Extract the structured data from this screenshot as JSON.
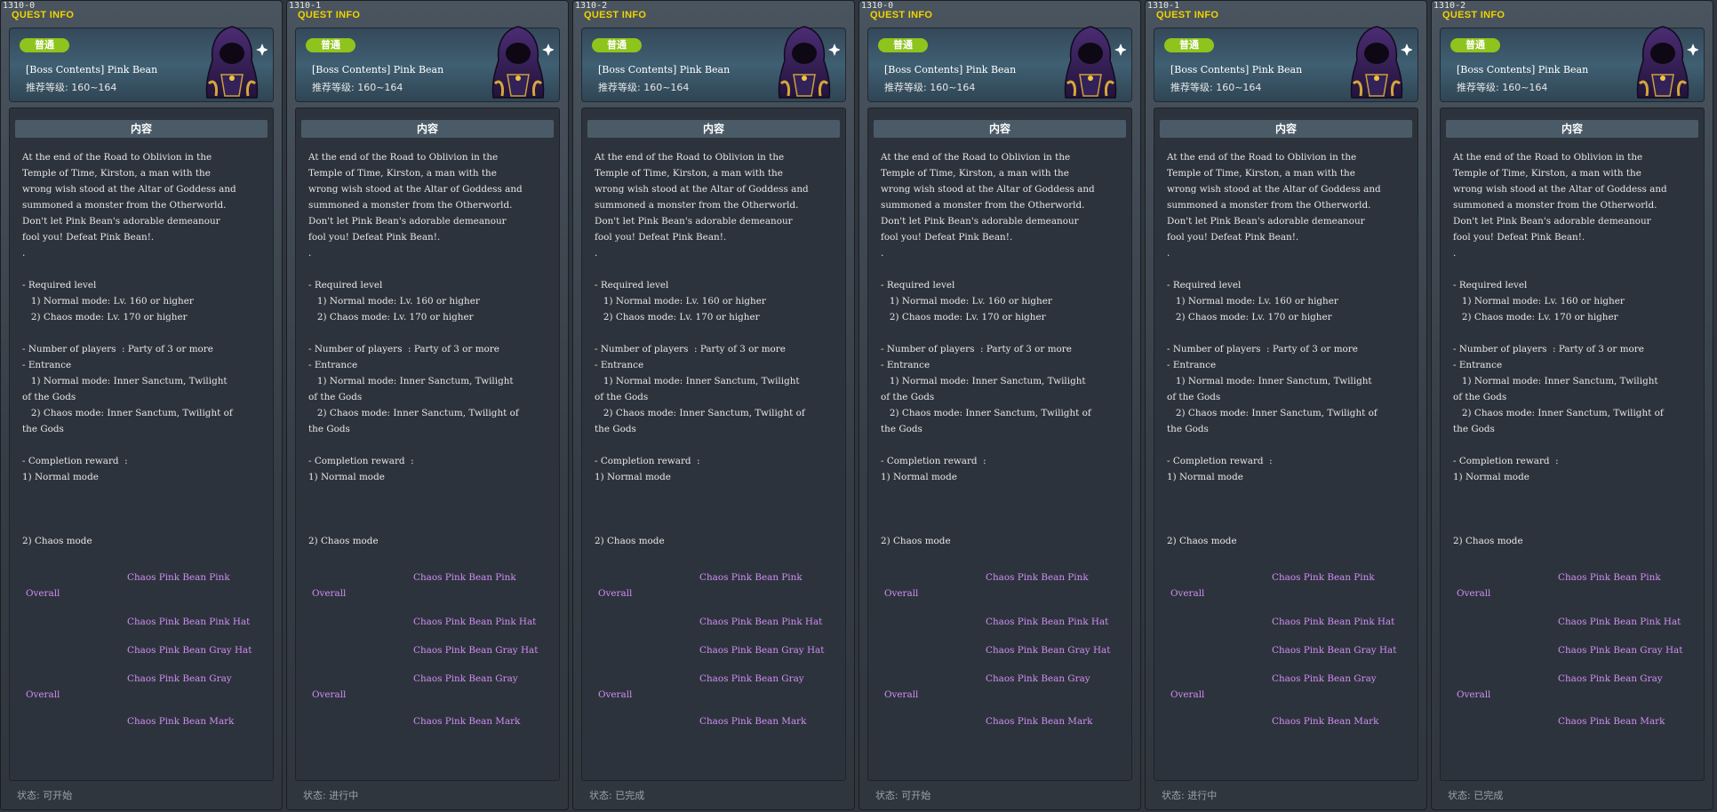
{
  "panels": [
    {
      "id": "1310-0",
      "status": "状态: 可开始"
    },
    {
      "id": "1310-1",
      "status": "状态: 进行中"
    },
    {
      "id": "1310-2",
      "status": "状态: 已完成"
    },
    {
      "id": "1310-0",
      "status": "状态: 可开始"
    },
    {
      "id": "1310-1",
      "status": "状态: 进行中"
    },
    {
      "id": "1310-2",
      "status": "状态: 已完成"
    }
  ],
  "common": {
    "title": "QUEST INFO",
    "badge": "普通",
    "quest_name": "[Boss Contents] Pink Bean",
    "recommended_level": "推荐等级: 160~164",
    "content_header": "内容",
    "boss_icon": "dark-hooded-mage-icon",
    "description": "At the end of the Road to Oblivion in the\nTemple of Time, Kirston, a man with the\nwrong wish stood at the Altar of Goddess and\nsummoned a monster from the Otherworld.\nDon't let Pink Bean's adorable demeanour\nfool you! Defeat Pink Bean!.\n.\n\n- Required level\n   1) Normal mode: Lv. 160 or higher\n   2) Chaos mode: Lv. 170 or higher\n\n- Number of players  : Party of 3 or more\n- Entrance\n   1) Normal mode: Inner Sanctum, Twilight\nof the Gods\n   2) Chaos mode: Inner Sanctum, Twilight of\nthe Gods\n\n- Completion reward  :\n1) Normal mode\n\n\n\n2) Chaos mode",
    "rewards": [
      {
        "line1": "Chaos Pink Bean Pink",
        "line2": "Overall"
      },
      {
        "line1": "Chaos Pink Bean Pink Hat",
        "line2": ""
      },
      {
        "line1": "Chaos Pink Bean Gray Hat",
        "line2": ""
      },
      {
        "line1": "Chaos Pink Bean Gray",
        "line2": "Overall"
      },
      {
        "line1": "Chaos Pink Bean Mark",
        "line2": ""
      }
    ]
  },
  "colors": {
    "title": "#f1d300",
    "badge": "#8fc41d",
    "reward": "#d08ef4",
    "status": "#9ba3ab"
  }
}
